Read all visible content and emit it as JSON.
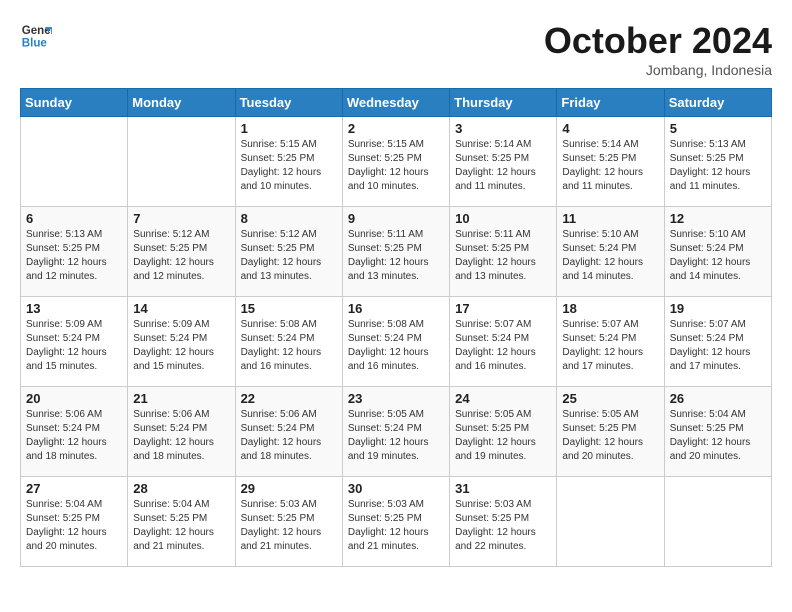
{
  "logo": {
    "line1": "General",
    "line2": "Blue"
  },
  "header": {
    "month": "October 2024",
    "location": "Jombang, Indonesia"
  },
  "weekdays": [
    "Sunday",
    "Monday",
    "Tuesday",
    "Wednesday",
    "Thursday",
    "Friday",
    "Saturday"
  ],
  "weeks": [
    [
      {
        "day": null
      },
      {
        "day": null
      },
      {
        "day": "1",
        "sunrise": "5:15 AM",
        "sunset": "5:25 PM",
        "daylight": "12 hours and 10 minutes."
      },
      {
        "day": "2",
        "sunrise": "5:15 AM",
        "sunset": "5:25 PM",
        "daylight": "12 hours and 10 minutes."
      },
      {
        "day": "3",
        "sunrise": "5:14 AM",
        "sunset": "5:25 PM",
        "daylight": "12 hours and 11 minutes."
      },
      {
        "day": "4",
        "sunrise": "5:14 AM",
        "sunset": "5:25 PM",
        "daylight": "12 hours and 11 minutes."
      },
      {
        "day": "5",
        "sunrise": "5:13 AM",
        "sunset": "5:25 PM",
        "daylight": "12 hours and 11 minutes."
      }
    ],
    [
      {
        "day": "6",
        "sunrise": "5:13 AM",
        "sunset": "5:25 PM",
        "daylight": "12 hours and 12 minutes."
      },
      {
        "day": "7",
        "sunrise": "5:12 AM",
        "sunset": "5:25 PM",
        "daylight": "12 hours and 12 minutes."
      },
      {
        "day": "8",
        "sunrise": "5:12 AM",
        "sunset": "5:25 PM",
        "daylight": "12 hours and 13 minutes."
      },
      {
        "day": "9",
        "sunrise": "5:11 AM",
        "sunset": "5:25 PM",
        "daylight": "12 hours and 13 minutes."
      },
      {
        "day": "10",
        "sunrise": "5:11 AM",
        "sunset": "5:25 PM",
        "daylight": "12 hours and 13 minutes."
      },
      {
        "day": "11",
        "sunrise": "5:10 AM",
        "sunset": "5:24 PM",
        "daylight": "12 hours and 14 minutes."
      },
      {
        "day": "12",
        "sunrise": "5:10 AM",
        "sunset": "5:24 PM",
        "daylight": "12 hours and 14 minutes."
      }
    ],
    [
      {
        "day": "13",
        "sunrise": "5:09 AM",
        "sunset": "5:24 PM",
        "daylight": "12 hours and 15 minutes."
      },
      {
        "day": "14",
        "sunrise": "5:09 AM",
        "sunset": "5:24 PM",
        "daylight": "12 hours and 15 minutes."
      },
      {
        "day": "15",
        "sunrise": "5:08 AM",
        "sunset": "5:24 PM",
        "daylight": "12 hours and 16 minutes."
      },
      {
        "day": "16",
        "sunrise": "5:08 AM",
        "sunset": "5:24 PM",
        "daylight": "12 hours and 16 minutes."
      },
      {
        "day": "17",
        "sunrise": "5:07 AM",
        "sunset": "5:24 PM",
        "daylight": "12 hours and 16 minutes."
      },
      {
        "day": "18",
        "sunrise": "5:07 AM",
        "sunset": "5:24 PM",
        "daylight": "12 hours and 17 minutes."
      },
      {
        "day": "19",
        "sunrise": "5:07 AM",
        "sunset": "5:24 PM",
        "daylight": "12 hours and 17 minutes."
      }
    ],
    [
      {
        "day": "20",
        "sunrise": "5:06 AM",
        "sunset": "5:24 PM",
        "daylight": "12 hours and 18 minutes."
      },
      {
        "day": "21",
        "sunrise": "5:06 AM",
        "sunset": "5:24 PM",
        "daylight": "12 hours and 18 minutes."
      },
      {
        "day": "22",
        "sunrise": "5:06 AM",
        "sunset": "5:24 PM",
        "daylight": "12 hours and 18 minutes."
      },
      {
        "day": "23",
        "sunrise": "5:05 AM",
        "sunset": "5:24 PM",
        "daylight": "12 hours and 19 minutes."
      },
      {
        "day": "24",
        "sunrise": "5:05 AM",
        "sunset": "5:25 PM",
        "daylight": "12 hours and 19 minutes."
      },
      {
        "day": "25",
        "sunrise": "5:05 AM",
        "sunset": "5:25 PM",
        "daylight": "12 hours and 20 minutes."
      },
      {
        "day": "26",
        "sunrise": "5:04 AM",
        "sunset": "5:25 PM",
        "daylight": "12 hours and 20 minutes."
      }
    ],
    [
      {
        "day": "27",
        "sunrise": "5:04 AM",
        "sunset": "5:25 PM",
        "daylight": "12 hours and 20 minutes."
      },
      {
        "day": "28",
        "sunrise": "5:04 AM",
        "sunset": "5:25 PM",
        "daylight": "12 hours and 21 minutes."
      },
      {
        "day": "29",
        "sunrise": "5:03 AM",
        "sunset": "5:25 PM",
        "daylight": "12 hours and 21 minutes."
      },
      {
        "day": "30",
        "sunrise": "5:03 AM",
        "sunset": "5:25 PM",
        "daylight": "12 hours and 21 minutes."
      },
      {
        "day": "31",
        "sunrise": "5:03 AM",
        "sunset": "5:25 PM",
        "daylight": "12 hours and 22 minutes."
      },
      {
        "day": null
      },
      {
        "day": null
      }
    ]
  ],
  "labels": {
    "sunrise": "Sunrise:",
    "sunset": "Sunset:",
    "daylight": "Daylight:"
  }
}
